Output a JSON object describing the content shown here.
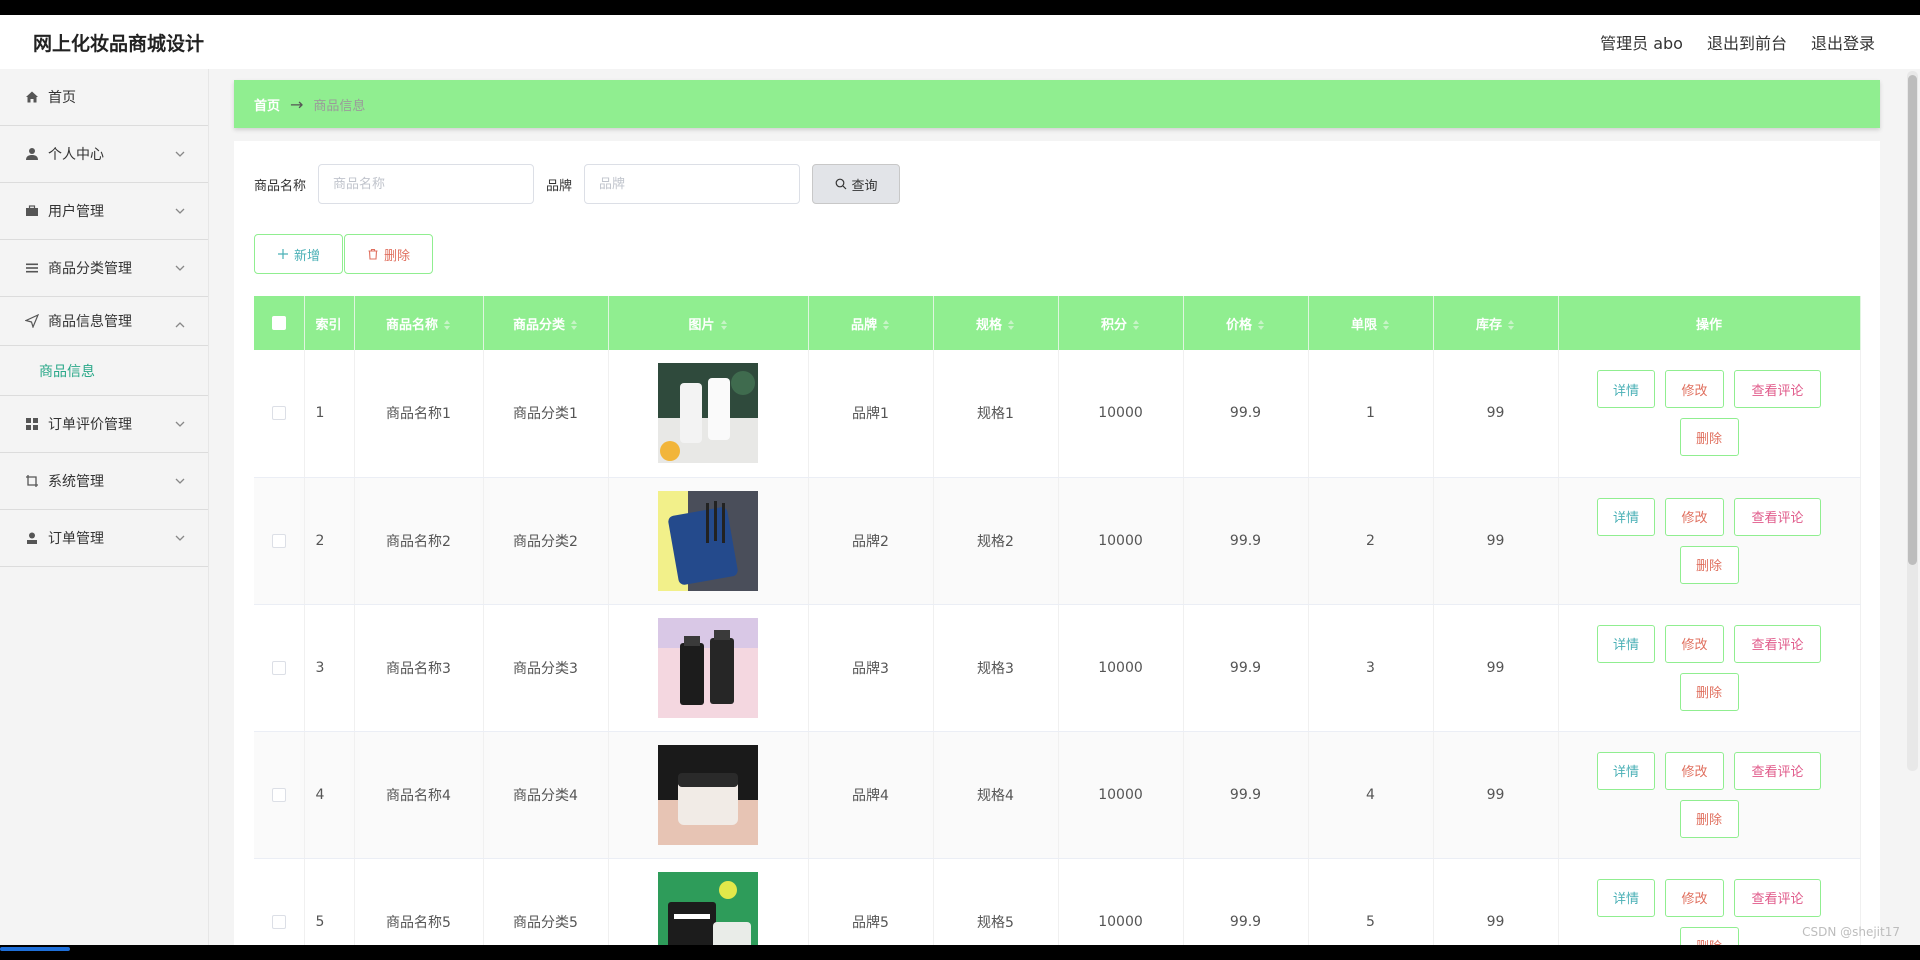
{
  "header": {
    "title": "网上化妆品商城设计",
    "admin_label": "管理员 abo",
    "to_front": "退出到前台",
    "logout": "退出登录"
  },
  "sidebar": {
    "items": [
      {
        "label": "首页",
        "icon": "home-icon"
      },
      {
        "label": "个人中心",
        "icon": "user-icon"
      },
      {
        "label": "用户管理",
        "icon": "briefcase-icon"
      },
      {
        "label": "商品分类管理",
        "icon": "list-icon"
      },
      {
        "label": "商品信息管理",
        "icon": "send-icon"
      },
      {
        "label": "订单评价管理",
        "icon": "grid-icon"
      },
      {
        "label": "系统管理",
        "icon": "crop-icon"
      },
      {
        "label": "订单管理",
        "icon": "person-icon"
      }
    ],
    "sub_item": "商品信息"
  },
  "breadcrumb": {
    "home": "首页",
    "arrow": "→",
    "current": "商品信息"
  },
  "search": {
    "name_label": "商品名称",
    "name_placeholder": "商品名称",
    "brand_label": "品牌",
    "brand_placeholder": "品牌",
    "query_button": "查询"
  },
  "actions": {
    "add": "新增",
    "delete": "删除"
  },
  "table": {
    "headers": [
      "索引",
      "商品名称",
      "商品分类",
      "图片",
      "品牌",
      "规格",
      "积分",
      "价格",
      "单限",
      "库存",
      "操作"
    ],
    "rows": [
      {
        "index": "1",
        "name": "商品名称1",
        "category": "商品分类1",
        "brand": "品牌1",
        "spec": "规格1",
        "points": "10000",
        "price": "99.9",
        "limit": "1",
        "stock": "99"
      },
      {
        "index": "2",
        "name": "商品名称2",
        "category": "商品分类2",
        "brand": "品牌2",
        "spec": "规格2",
        "points": "10000",
        "price": "99.9",
        "limit": "2",
        "stock": "99"
      },
      {
        "index": "3",
        "name": "商品名称3",
        "category": "商品分类3",
        "brand": "品牌3",
        "spec": "规格3",
        "points": "10000",
        "price": "99.9",
        "limit": "3",
        "stock": "99"
      },
      {
        "index": "4",
        "name": "商品名称4",
        "category": "商品分类4",
        "brand": "品牌4",
        "spec": "规格4",
        "points": "10000",
        "price": "99.9",
        "limit": "4",
        "stock": "99"
      },
      {
        "index": "5",
        "name": "商品名称5",
        "category": "商品分类5",
        "brand": "品牌5",
        "spec": "规格5",
        "points": "10000",
        "price": "99.9",
        "limit": "5",
        "stock": "99"
      }
    ],
    "op_labels": {
      "detail": "详情",
      "edit": "修改",
      "review": "查看评论",
      "delete": "删除"
    }
  },
  "watermark": "CSDN @shejit17",
  "colors": {
    "accent_green": "#90ee90",
    "active_menu": "#2aa889",
    "teal_text": "#4ab0b6",
    "red_text": "#e0705f"
  }
}
